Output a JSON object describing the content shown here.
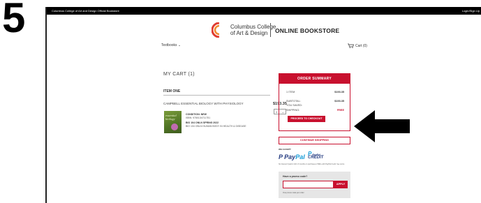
{
  "step_number": "5",
  "topbar": {
    "site": "Columbus College of Art and Design Official Bookstore",
    "login": "Login/Sign Up"
  },
  "logo": {
    "line1": "Columbus College",
    "line2": "of Art & Design",
    "store": "ONLINE BOOKSTORE"
  },
  "nav": {
    "textbooks": "Textbooks",
    "cart": "Cart (0)"
  },
  "cart": {
    "title": "MY CART (1)",
    "item_heading": "ITEM ONE",
    "product": {
      "title": "CAMPBELL ESSENTIAL BIOLOGY WITH PHYSIOLOGY",
      "price": "$193.35",
      "quantity": "1",
      "cover_title": "essential biology",
      "condition": "CONDITION: NEW",
      "isbn": "ISBN: 9780134711751",
      "course": "BIO 104 ONLN  SPRING 2022",
      "course_desc": "BIO 104 ONLN HUMAN BODY IN HEALTH & DISEASE"
    }
  },
  "summary": {
    "title": "ORDER SUMMARY",
    "rows": [
      {
        "label": "1 ITEM",
        "value": "$193.35"
      },
      {
        "label": "SUBTOTAL:",
        "value": "$193.35"
      },
      {
        "label": "YOU SAVED:",
        "value": ""
      },
      {
        "label": "SHIPPING:",
        "value": "FREE"
      }
    ],
    "checkout": "PROCEED TO CHECKOUT",
    "continue": "CONTINUE SHOPPING"
  },
  "payment": {
    "accept_label": "WE ACCEPT",
    "paypal_a": "Pay",
    "paypal_b": "Pal",
    "credit_a": "PayPal",
    "credit_b": "CREDIT",
    "fineprint": "No Interest if paid in full in 6 months on purchases of $99+ with PayPal Credit. See terms."
  },
  "promo": {
    "question": "Have a promo code?",
    "apply": "APPLY",
    "note": "One promo code per order"
  },
  "colors": {
    "accent": "#c8102e",
    "bar": "#000000"
  }
}
